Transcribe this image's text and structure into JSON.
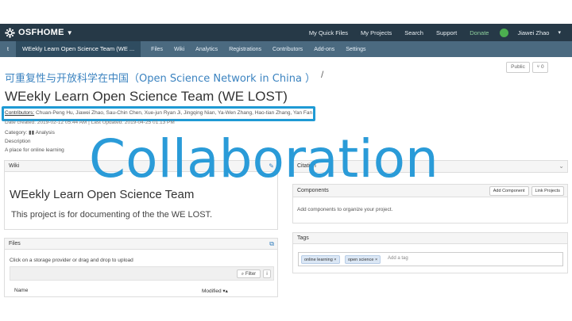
{
  "navbar": {
    "brand": "OSFHOME",
    "links": [
      "My Quick Files",
      "My Projects",
      "Search",
      "Support",
      "Donate"
    ],
    "user_name": "Jiawei Zhao"
  },
  "project_nav": {
    "home_symbol": "t",
    "title": "WEekly Learn Open Science Team (WE ...",
    "tabs": [
      "Files",
      "Wiki",
      "Analytics",
      "Registrations",
      "Contributors",
      "Add-ons",
      "Settings"
    ]
  },
  "header": {
    "parent_link": "可重复性与开放科学在中国（Open Science Network in China ）",
    "separator": "/",
    "public_button": "Public",
    "fork_button": "0",
    "title": "WEekly Learn Open Science Team (WE LOST)"
  },
  "contributors": {
    "label": "Contributors:",
    "names": "Chuan-Peng Hu, Jiawei Zhao, Sau-Chin Chen, Xue-jun Ryan Ji, Jingqing Nian, Ya-Wen Zhang, Hao-tian Zhang, Yan Fan"
  },
  "meta": {
    "created": "Date created: 2019-02-12 05:44 AM | Last Updated: 2019-04-25 01:13 PM",
    "category_label": "Category:",
    "category": "Analysis",
    "description_label": "Description",
    "description": "A place for online learning"
  },
  "wiki": {
    "title": "Wiki",
    "heading": "WEekly Learn Open Science Team",
    "body": "This project is for documenting of the the WE LOST."
  },
  "files": {
    "title": "Files",
    "hint": "Click on a storage provider or drag and drop to upload",
    "filter": "Filter",
    "col_name": "Name",
    "col_modified": "Modified"
  },
  "citation": {
    "title": "Citation"
  },
  "components": {
    "title": "Components",
    "add": "Add Component",
    "link": "Link Projects",
    "empty": "Add components to organize your project."
  },
  "tags": {
    "title": "Tags",
    "items": [
      "online learning ×",
      "open science ×"
    ],
    "add_placeholder": "Add a tag"
  },
  "overlay_text": "Collaboration",
  "colors": {
    "nav": "#263947",
    "project_nav": "#4b6a80",
    "accent": "#1f9ad4",
    "link": "#3b83c0"
  }
}
